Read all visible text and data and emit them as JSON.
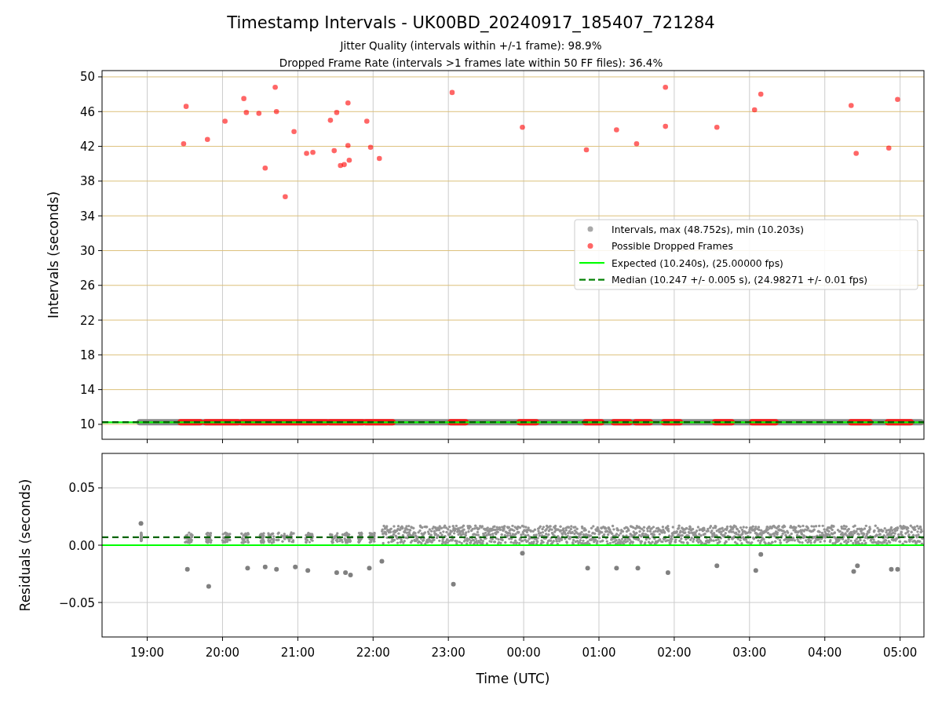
{
  "figure": {
    "title": "Timestamp Intervals - UK00BD_20240917_185407_721284",
    "subtitles": [
      "Jitter Quality (intervals within +/-1 frame): 98.9%",
      "Dropped Frame Rate (intervals >1 frames late within 50 FF files): 36.4%"
    ]
  },
  "intervals_plot": {
    "legend": [
      {
        "kind": "dot",
        "label": "Intervals, max (48.752s), min (10.203s)",
        "color": "#a9a9a9"
      },
      {
        "kind": "dot",
        "label": "Possible Dropped Frames",
        "color": "#ff6666"
      },
      {
        "kind": "line",
        "label": "Expected (10.240s), (25.00000 fps)",
        "color": "#00ff00"
      },
      {
        "kind": "dashed",
        "label": "Median (10.247 +/- 0.005 s), (24.98271 +/- 0.01 fps)",
        "color": "#008000"
      }
    ],
    "chart_data": {
      "type": "scatter",
      "ylabel": "Intervals (seconds)",
      "grid": true,
      "xlim": [
        "2024-09-17T18:24",
        "2024-09-18T05:19"
      ],
      "ylim": [
        8.28,
        50.72
      ],
      "yticks": [
        {
          "value": 10,
          "label": "10"
        },
        {
          "value": 14,
          "label": "14"
        },
        {
          "value": 18,
          "label": "18"
        },
        {
          "value": 22,
          "label": "22"
        },
        {
          "value": 26,
          "label": "26"
        },
        {
          "value": 30,
          "label": "30"
        },
        {
          "value": 34,
          "label": "34"
        },
        {
          "value": 38,
          "label": "38"
        },
        {
          "value": 42,
          "label": "42"
        },
        {
          "value": 46,
          "label": "46"
        },
        {
          "value": 50,
          "label": "50"
        }
      ],
      "series": [
        {
          "color": "#ff0000",
          "x": [
            "2024-09-17T19:29",
            "2024-09-17T19:31",
            "2024-09-17T19:48",
            "2024-09-17T20:02",
            "2024-09-17T20:17",
            "2024-09-17T20:19",
            "2024-09-17T20:29",
            "2024-09-17T20:34",
            "2024-09-17T20:42",
            "2024-09-17T20:43",
            "2024-09-17T20:50",
            "2024-09-17T20:57",
            "2024-09-17T21:07",
            "2024-09-17T21:12",
            "2024-09-17T21:26",
            "2024-09-17T21:29",
            "2024-09-17T21:31",
            "2024-09-17T21:34",
            "2024-09-17T21:37",
            "2024-09-17T21:40",
            "2024-09-17T21:40",
            "2024-09-17T21:41",
            "2024-09-17T21:55",
            "2024-09-17T21:58",
            "2024-09-17T22:05",
            "2024-09-17T23:03",
            "2024-09-17T23:59",
            "2024-09-18T00:50",
            "2024-09-18T01:14",
            "2024-09-18T01:30",
            "2024-09-18T01:53",
            "2024-09-18T01:53",
            "2024-09-18T02:34",
            "2024-09-18T03:04",
            "2024-09-18T03:09",
            "2024-09-18T04:21",
            "2024-09-18T04:25",
            "2024-09-18T04:51",
            "2024-09-18T04:58"
          ],
          "values": [
            42.3,
            46.6,
            42.8,
            44.9,
            47.5,
            45.9,
            45.8,
            39.5,
            48.8,
            46.0,
            36.2,
            43.7,
            41.2,
            41.3,
            45.0,
            41.5,
            45.9,
            39.8,
            39.9,
            47.0,
            42.1,
            40.4,
            44.9,
            41.9,
            40.6,
            48.2,
            44.2,
            41.6,
            43.9,
            42.3,
            48.8,
            44.3,
            44.2,
            46.2,
            48.0,
            46.7,
            41.2,
            41.8,
            47.4
          ]
        }
      ],
      "ref_lines": [
        {
          "axis": "y",
          "value": 10.24,
          "color": "#00ff00"
        },
        {
          "axis": "y",
          "value": 10.247,
          "color": "#006400"
        }
      ]
    }
  },
  "residuals_plot": {
    "chart_data": {
      "type": "scatter",
      "xlabel": "Time (UTC)",
      "ylabel": "Residuals (seconds)",
      "grid": true,
      "xlim": [
        "2024-09-17T18:24",
        "2024-09-18T05:19"
      ],
      "ylim": [
        -0.0801,
        0.0801
      ],
      "xticks": [
        {
          "value": "2024-09-17T19:00",
          "label": "19:00"
        },
        {
          "value": "2024-09-17T20:00",
          "label": "20:00"
        },
        {
          "value": "2024-09-17T21:00",
          "label": "21:00"
        },
        {
          "value": "2024-09-17T22:00",
          "label": "22:00"
        },
        {
          "value": "2024-09-17T23:00",
          "label": "23:00"
        },
        {
          "value": "2024-09-18T00:00",
          "label": "00:00"
        },
        {
          "value": "2024-09-18T01:00",
          "label": "01:00"
        },
        {
          "value": "2024-09-18T02:00",
          "label": "02:00"
        },
        {
          "value": "2024-09-18T03:00",
          "label": "03:00"
        },
        {
          "value": "2024-09-18T04:00",
          "label": "04:00"
        },
        {
          "value": "2024-09-18T05:00",
          "label": "05:00"
        }
      ],
      "yticks": [
        {
          "value": 0.05,
          "label": "0.05"
        },
        {
          "value": 0,
          "label": "0.00"
        },
        {
          "value": -0.05,
          "label": "−0.05"
        }
      ],
      "series": [
        {
          "color": "#808080",
          "x": [
            "2024-09-17T18:55",
            "2024-09-17T19:32",
            "2024-09-17T19:49",
            "2024-09-17T20:20",
            "2024-09-17T20:34",
            "2024-09-17T20:43",
            "2024-09-17T20:58",
            "2024-09-17T21:08",
            "2024-09-17T21:31",
            "2024-09-17T21:38",
            "2024-09-17T21:42",
            "2024-09-17T21:57",
            "2024-09-17T22:07",
            "2024-09-17T23:04",
            "2024-09-17T23:59",
            "2024-09-18T00:51",
            "2024-09-18T01:14",
            "2024-09-18T01:31",
            "2024-09-18T01:55",
            "2024-09-18T02:34",
            "2024-09-18T03:05",
            "2024-09-18T03:09",
            "2024-09-18T04:23",
            "2024-09-18T04:26",
            "2024-09-18T04:53",
            "2024-09-18T04:58"
          ],
          "values": [
            0.019,
            -0.021,
            -0.036,
            -0.02,
            -0.019,
            -0.021,
            -0.019,
            -0.022,
            -0.024,
            -0.024,
            -0.026,
            -0.02,
            -0.014,
            -0.034,
            -0.007,
            -0.02,
            -0.02,
            -0.02,
            -0.024,
            -0.018,
            -0.022,
            -0.008,
            -0.023,
            -0.018,
            -0.021,
            -0.021
          ]
        }
      ],
      "ref_lines": [
        {
          "axis": "y",
          "value": 0,
          "color": "#00ff00"
        },
        {
          "axis": "y",
          "value": 0.007,
          "color": "#006400"
        }
      ]
    }
  }
}
